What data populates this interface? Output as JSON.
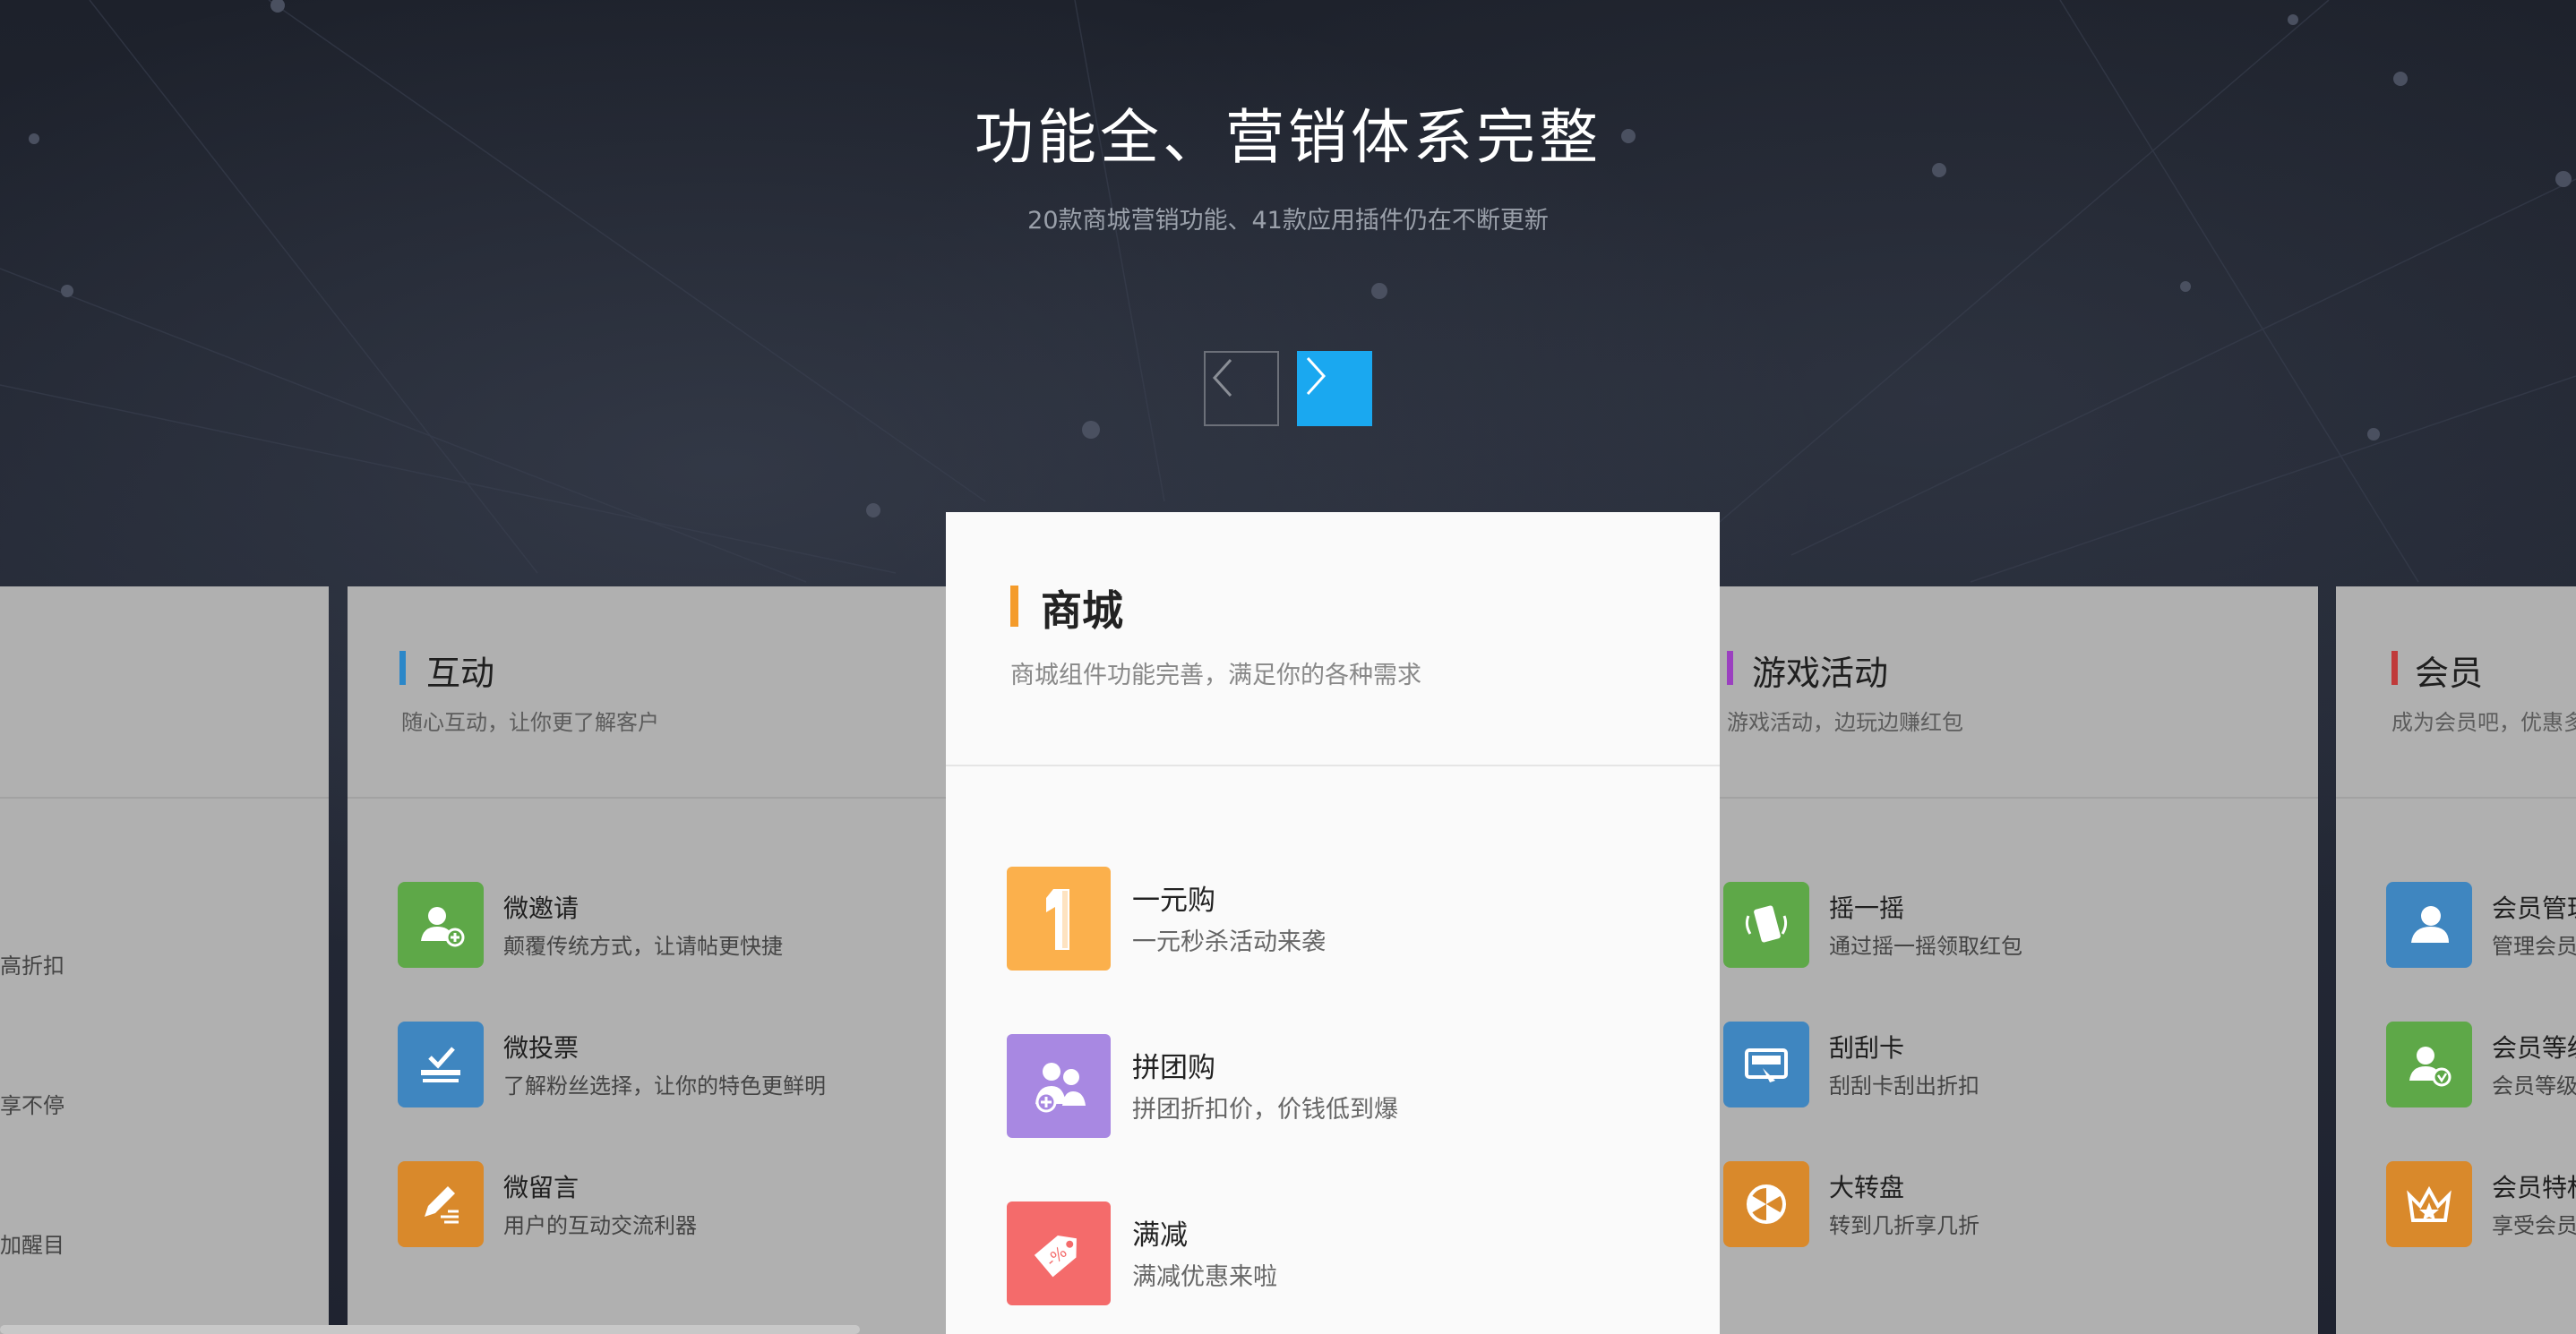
{
  "hero": {
    "title": "功能全、营销体系完整",
    "subtitle": "20款商城营销功能、41款应用插件仍在不断更新",
    "prev_icon": "chevron-left-icon",
    "next_icon": "chevron-right-icon",
    "accent": "#1aa8f0"
  },
  "cards": {
    "left_partial": {
      "items": [
        {
          "desc": "高折扣"
        },
        {
          "desc": "享不停"
        },
        {
          "desc": "加醒目"
        }
      ]
    },
    "interaction": {
      "title": "互动",
      "desc": "随心互动，让你更了解客户",
      "color": "#2b87c8",
      "items": [
        {
          "name": "微邀请",
          "desc": "颠覆传统方式，让请帖更快捷",
          "icon": "user-add-icon",
          "color": "#5ea848"
        },
        {
          "name": "微投票",
          "desc": "了解粉丝选择，让你的特色更鲜明",
          "icon": "vote-icon",
          "color": "#3f86c0"
        },
        {
          "name": "微留言",
          "desc": "用户的互动交流利器",
          "icon": "edit-icon",
          "color": "#d9892b"
        }
      ]
    },
    "mall": {
      "title": "商城",
      "desc": "商城组件功能完善，满足你的各种需求",
      "color": "#f49b2a",
      "items": [
        {
          "name": "一元购",
          "desc": "一元秒杀活动来袭",
          "icon": "number-one-icon",
          "color": "#fbb04c"
        },
        {
          "name": "拼团购",
          "desc": "拼团折扣价，价钱低到爆",
          "icon": "group-icon",
          "color": "#a888e2"
        },
        {
          "name": "满减",
          "desc": "满减优惠来啦",
          "icon": "discount-tag-icon",
          "color": "#f46b6b"
        }
      ]
    },
    "games": {
      "title": "游戏活动",
      "desc": "游戏活动，边玩边赚红包",
      "color": "#9b3fc0",
      "items": [
        {
          "name": "摇一摇",
          "desc": "通过摇一摇领取红包",
          "icon": "shake-phone-icon",
          "color": "#5ea848"
        },
        {
          "name": "刮刮卡",
          "desc": "刮刮卡刮出折扣",
          "icon": "scratch-card-icon",
          "color": "#3f86c0"
        },
        {
          "name": "大转盘",
          "desc": "转到几折享几折",
          "icon": "wheel-icon",
          "color": "#d9892b"
        }
      ]
    },
    "member": {
      "title": "会员",
      "desc": "成为会员吧，优惠多",
      "color": "#c03a3a",
      "items": [
        {
          "name": "会员管理",
          "desc": "管理会员",
          "icon": "member-icon",
          "color": "#3f86c0"
        },
        {
          "name": "会员等级",
          "desc": "会员等级",
          "icon": "member-level-icon",
          "color": "#5ea848"
        },
        {
          "name": "会员特权",
          "desc": "享受会员",
          "icon": "crown-icon",
          "color": "#d9892b"
        }
      ]
    }
  }
}
